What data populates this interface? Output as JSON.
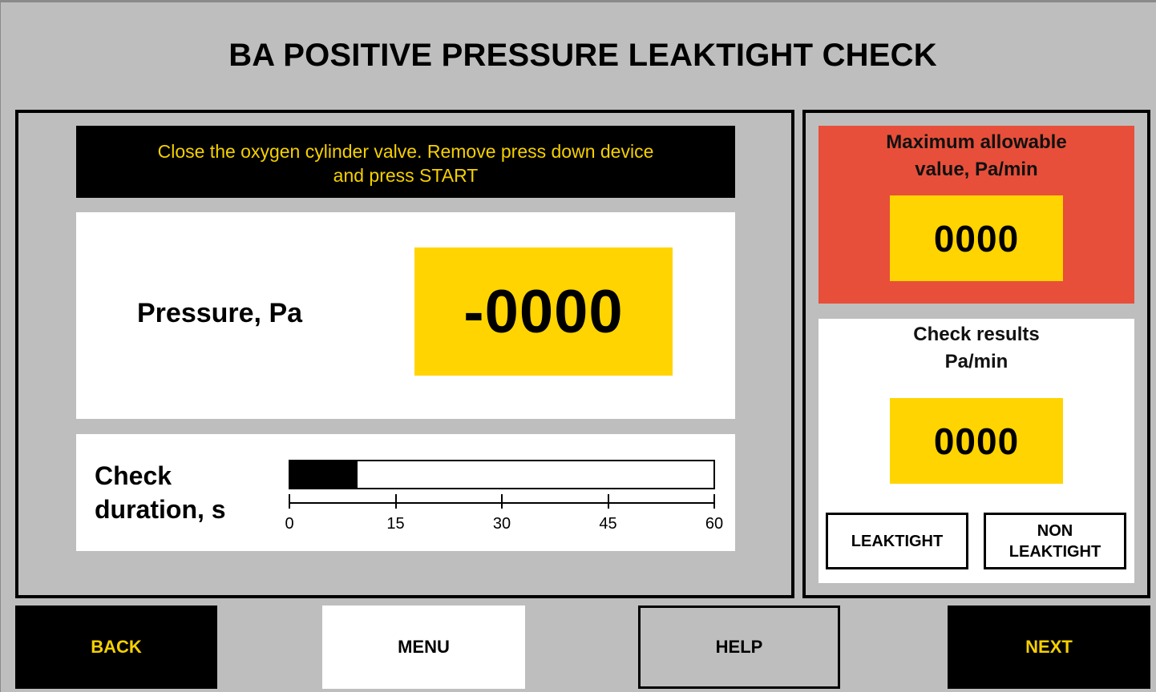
{
  "title": "BA POSITIVE PRESSURE LEAKTIGHT CHECK",
  "instruction": {
    "line1": "Close the oxygen cylinder valve. Remove  press down device",
    "line2": "and press START"
  },
  "pressure": {
    "label": "Pressure, Pa",
    "value": "-0000"
  },
  "check_duration": {
    "label_line1": "Check",
    "label_line2": "duration, s",
    "progress_fraction": 0.16,
    "scale_ticks": [
      "0",
      "15",
      "30",
      "45",
      "60"
    ]
  },
  "max_allowable": {
    "title_line1": "Maximum allowable",
    "title_line2": "value, Pa/min",
    "value": "0000"
  },
  "check_results": {
    "title_line1": "Check results",
    "title_line2": "Pa/min",
    "value": "0000",
    "leaktight_label": "LEAKTIGHT",
    "non_leaktight_line1": "NON",
    "non_leaktight_line2": "LEAKTIGHT"
  },
  "nav": {
    "back": "BACK",
    "menu": "MENU",
    "help": "HELP",
    "next": "NEXT"
  },
  "colors": {
    "background": "#bebebe",
    "accent_yellow": "#ffd400",
    "text_yellow": "#f5d000",
    "alert_red": "#e74f3a"
  }
}
